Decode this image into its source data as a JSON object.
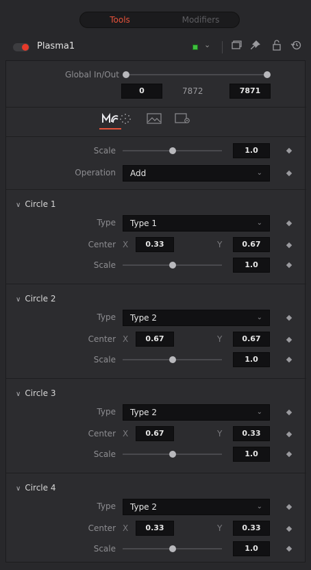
{
  "tabs": {
    "active": "Tools",
    "inactive": "Modifiers"
  },
  "header": {
    "tool_name": "Plasma1",
    "color_chip": "#3fbf3f",
    "icons": [
      "chevron-down-icon",
      "window-icon",
      "pin-icon",
      "lock-icon",
      "reset-icon"
    ]
  },
  "global": {
    "label": "Global In/Out",
    "in_value": "0",
    "mid_value": "7872",
    "out_value": "7871"
  },
  "control_tabs": [
    "plasma-icon",
    "particles-icon",
    "image-icon",
    "settings-icon"
  ],
  "main": {
    "scale_label": "Scale",
    "scale_value": "1.0",
    "scale_level": 0.5,
    "operation_label": "Operation",
    "operation_value": "Add"
  },
  "circles": [
    {
      "title": "Circle 1",
      "type_label": "Type",
      "type_value": "Type 1",
      "center_label": "Center",
      "x_label": "X",
      "x_value": "0.33",
      "y_label": "Y",
      "y_value": "0.67",
      "scale_label": "Scale",
      "scale_value": "1.0",
      "scale_level": 0.5
    },
    {
      "title": "Circle 2",
      "type_label": "Type",
      "type_value": "Type 2",
      "center_label": "Center",
      "x_label": "X",
      "x_value": "0.67",
      "y_label": "Y",
      "y_value": "0.67",
      "scale_label": "Scale",
      "scale_value": "1.0",
      "scale_level": 0.5
    },
    {
      "title": "Circle 3",
      "type_label": "Type",
      "type_value": "Type 2",
      "center_label": "Center",
      "x_label": "X",
      "x_value": "0.67",
      "y_label": "Y",
      "y_value": "0.33",
      "scale_label": "Scale",
      "scale_value": "1.0",
      "scale_level": 0.5
    },
    {
      "title": "Circle 4",
      "type_label": "Type",
      "type_value": "Type 2",
      "center_label": "Center",
      "x_label": "X",
      "x_value": "0.33",
      "y_label": "Y",
      "y_value": "0.33",
      "scale_label": "Scale",
      "scale_value": "1.0",
      "scale_level": 0.5
    }
  ],
  "colors": {
    "accent": "#e8533b",
    "record": "#e63a2a"
  }
}
